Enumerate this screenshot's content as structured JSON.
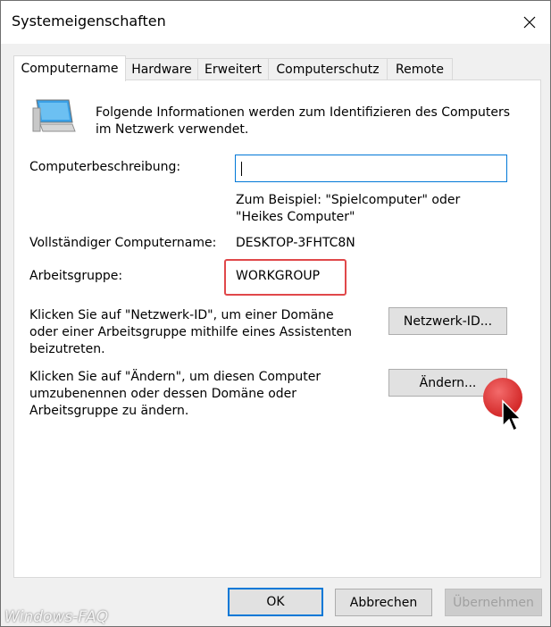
{
  "window": {
    "title": "Systemeigenschaften"
  },
  "tabs": [
    {
      "label": "Computername",
      "active": true
    },
    {
      "label": "Hardware",
      "active": false
    },
    {
      "label": "Erweitert",
      "active": false
    },
    {
      "label": "Computerschutz",
      "active": false
    },
    {
      "label": "Remote",
      "active": false
    }
  ],
  "info": {
    "line1": "Folgende Informationen werden zum Identifizieren des Computers",
    "line2": "im Netzwerk verwendet."
  },
  "description": {
    "label": "Computerbeschreibung:",
    "value": "",
    "hint_line1": "Zum Beispiel: \"Spielcomputer\" oder",
    "hint_line2": "\"Heikes Computer\""
  },
  "full_name": {
    "label": "Vollständiger Computername:",
    "value": "DESKTOP-3FHTC8N"
  },
  "workgroup": {
    "label": "Arbeitsgruppe:",
    "value": "WORKGROUP"
  },
  "network_id": {
    "line1": "Klicken Sie auf \"Netzwerk-ID\", um einer Domäne",
    "line2": "oder einer Arbeitsgruppe mithilfe eines Assistenten",
    "line3": "beizutreten.",
    "button": "Netzwerk-ID..."
  },
  "change": {
    "line1": "Klicken Sie auf \"Ändern\", um diesen Computer",
    "line2": "umzubenennen oder dessen Domäne oder",
    "line3": "Arbeitsgruppe zu ändern.",
    "button": "Ändern..."
  },
  "footer": {
    "ok": "OK",
    "cancel": "Abbrechen",
    "apply": "Übernehmen"
  },
  "watermark": "Windows-FAQ",
  "colors": {
    "accent": "#0078d7",
    "highlight": "#e0484a"
  },
  "icons": {
    "close": "close-icon",
    "computer": "computer-icon",
    "cursor": "mouse-cursor-icon"
  }
}
